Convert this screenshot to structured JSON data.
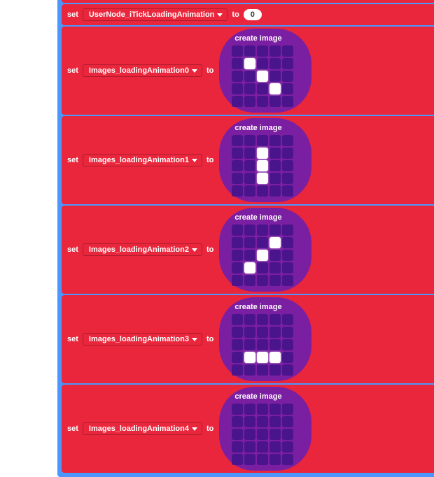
{
  "labels": {
    "set": "set",
    "to": "to",
    "create_image": "create image"
  },
  "blocks": [
    {
      "var": "UserNode_iTickLoadingAnimation",
      "value": "0",
      "type": "number"
    },
    {
      "var": "Images_loadingAnimation0",
      "type": "image",
      "pixels": [
        0,
        0,
        0,
        0,
        0,
        0,
        1,
        0,
        0,
        0,
        0,
        0,
        1,
        0,
        0,
        0,
        0,
        0,
        1,
        0,
        0,
        0,
        0,
        0,
        0
      ]
    },
    {
      "var": "Images_loadingAnimation1",
      "type": "image",
      "pixels": [
        0,
        0,
        0,
        0,
        0,
        0,
        0,
        1,
        0,
        0,
        0,
        0,
        1,
        0,
        0,
        0,
        0,
        1,
        0,
        0,
        0,
        0,
        0,
        0,
        0
      ]
    },
    {
      "var": "Images_loadingAnimation2",
      "type": "image",
      "pixels": [
        0,
        0,
        0,
        0,
        0,
        0,
        0,
        0,
        1,
        0,
        0,
        0,
        1,
        0,
        0,
        0,
        1,
        0,
        0,
        0,
        0,
        0,
        0,
        0,
        0
      ]
    },
    {
      "var": "Images_loadingAnimation3",
      "type": "image",
      "pixels": [
        0,
        0,
        0,
        0,
        0,
        0,
        0,
        0,
        0,
        0,
        0,
        0,
        0,
        0,
        0,
        0,
        1,
        1,
        1,
        0,
        0,
        0,
        0,
        0,
        0
      ]
    },
    {
      "var": "Images_loadingAnimation4",
      "type": "image",
      "pixels": [
        0,
        0,
        0,
        0,
        0,
        0,
        0,
        0,
        0,
        0,
        0,
        0,
        0,
        0,
        0,
        0,
        0,
        0,
        0,
        0,
        0,
        0,
        0,
        0,
        0
      ]
    }
  ]
}
